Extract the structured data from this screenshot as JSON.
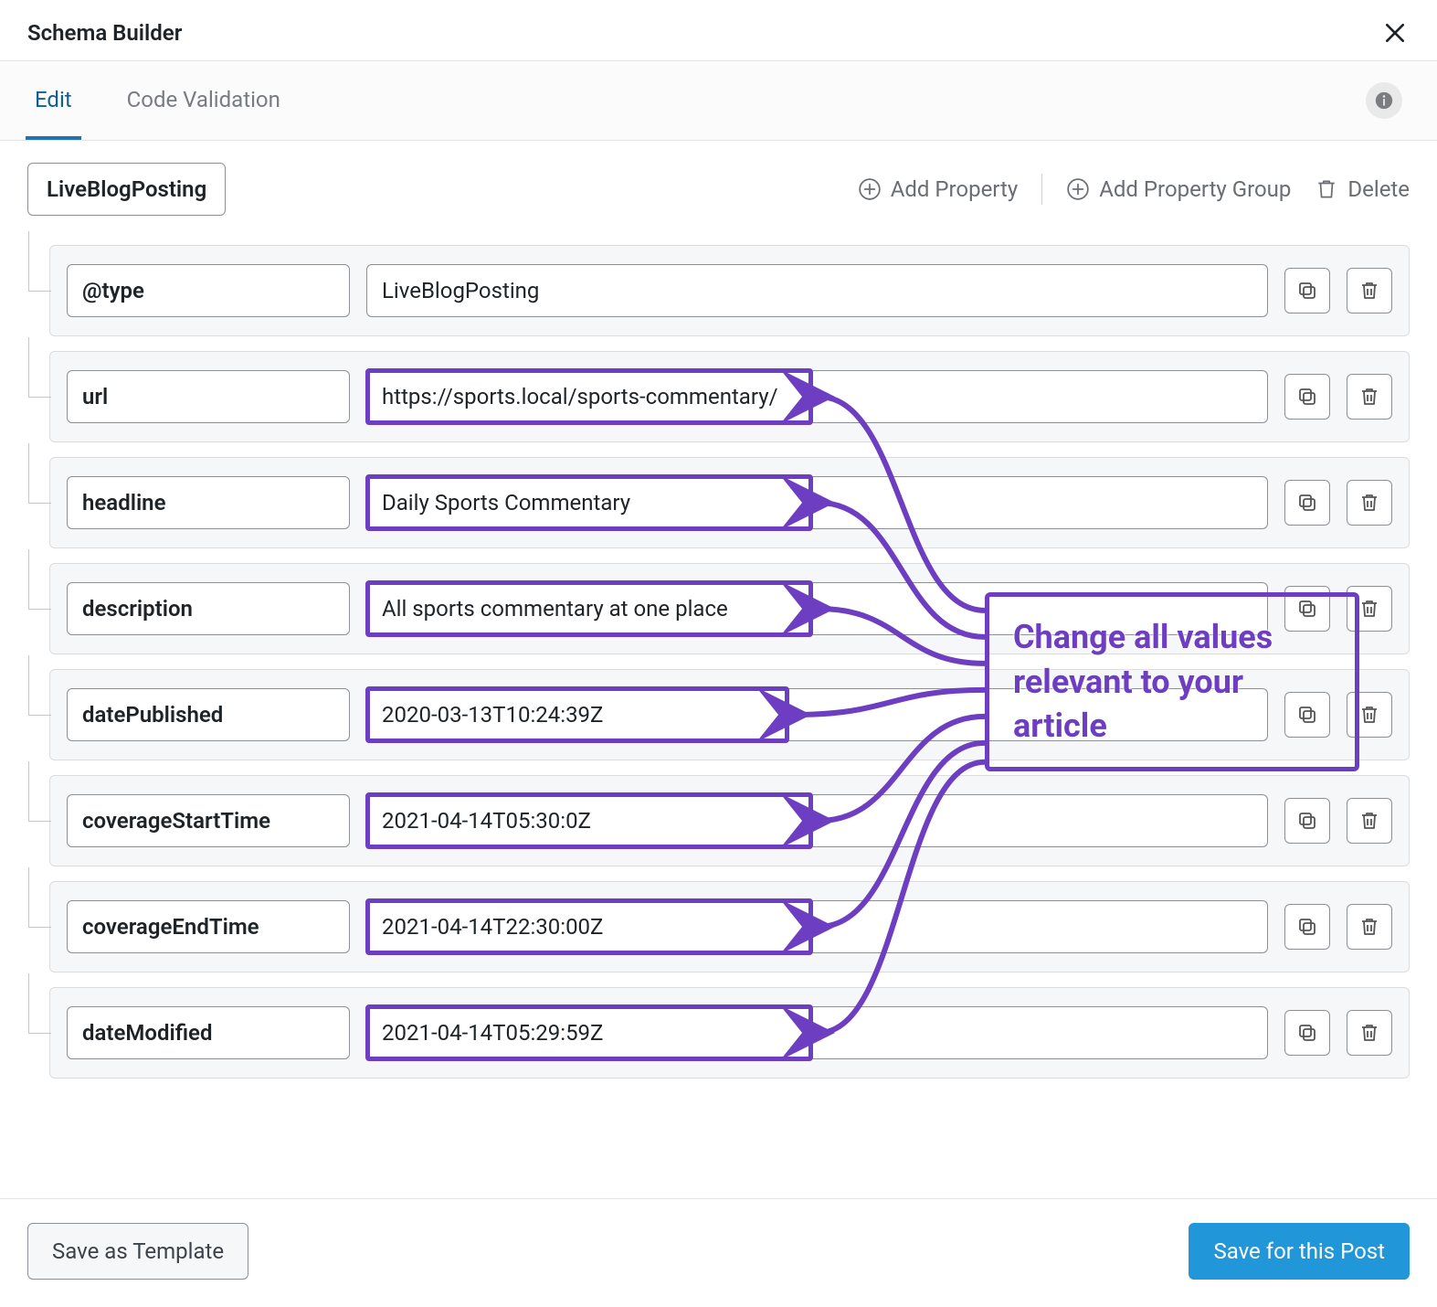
{
  "header": {
    "title": "Schema Builder"
  },
  "tabs": {
    "edit": "Edit",
    "validate": "Code Validation"
  },
  "toolbar": {
    "type_label": "LiveBlogPosting",
    "add_property": "Add Property",
    "add_group": "Add Property Group",
    "delete": "Delete"
  },
  "props": [
    {
      "key": "@type",
      "value": "LiveBlogPosting",
      "hl": false,
      "hlw": 0
    },
    {
      "key": "url",
      "value": "https://sports.local/sports-commentary/",
      "hl": true,
      "hlw": 490
    },
    {
      "key": "headline",
      "value": "Daily Sports Commentary",
      "hl": true,
      "hlw": 490
    },
    {
      "key": "description",
      "value": "All sports commentary at one place",
      "hl": true,
      "hlw": 490
    },
    {
      "key": "datePublished",
      "value": "2020-03-13T10:24:39Z",
      "hl": true,
      "hlw": 464
    },
    {
      "key": "coverageStartTime",
      "value": "2021-04-14T05:30:0Z",
      "hl": true,
      "hlw": 490
    },
    {
      "key": "coverageEndTime",
      "value": "2021-04-14T22:30:00Z",
      "hl": true,
      "hlw": 490
    },
    {
      "key": "dateModified",
      "value": "2021-04-14T05:29:59Z",
      "hl": true,
      "hlw": 490
    }
  ],
  "annotation": {
    "text": "Change all values relevant to your article"
  },
  "footer": {
    "save_template": "Save as Template",
    "save_post": "Save for this Post"
  },
  "colors": {
    "accent": "#2271b1",
    "primary_btn": "#2196d9",
    "highlight": "#6d3ec1"
  }
}
